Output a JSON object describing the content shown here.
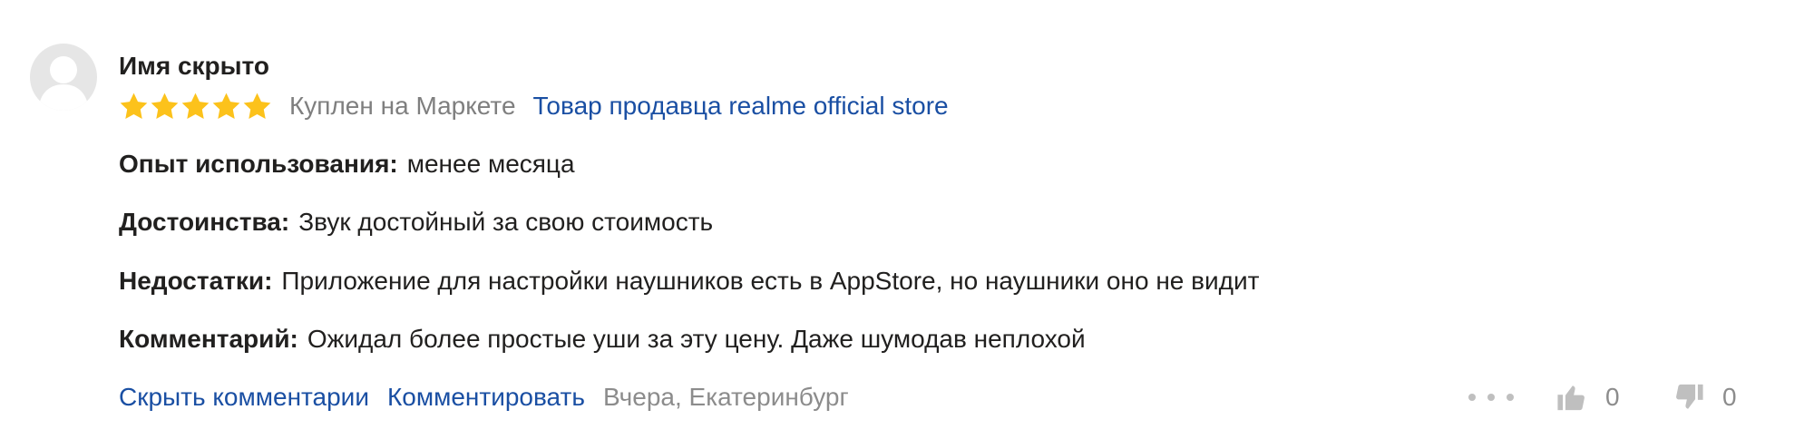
{
  "review": {
    "author": "Имя скрыто",
    "rating": 5,
    "rating_max": 5,
    "purchase_badge": "Куплен на Маркете",
    "seller_link": "Товар продавца realme official store",
    "fields": [
      {
        "label": "Опыт использования:",
        "value": "менее месяца"
      },
      {
        "label": "Достоинства:",
        "value": "Звук достойный за свою стоимость"
      },
      {
        "label": "Недостатки:",
        "value": "Приложение для настройки наушников есть в AppStore, но наушники оно не видит"
      },
      {
        "label": "Комментарий:",
        "value": "Ожидал более простые уши за эту цену. Даже шумодав неплохой"
      }
    ],
    "footer": {
      "hide_comments": "Скрыть комментарии",
      "comment": "Комментировать",
      "date_city": "Вчера, Екатеринбург"
    },
    "votes": {
      "likes": "0",
      "dislikes": "0"
    }
  },
  "colors": {
    "star": "#fcc21b",
    "link": "#1a4fa3",
    "muted_text": "#7f7f7f",
    "icon_gray": "#bfbfbf",
    "avatar_bg": "#e6e6e6"
  },
  "icons": {
    "avatar": "user-silhouette",
    "star": "star-filled",
    "more": "three-dots",
    "like": "thumbs-up",
    "dislike": "thumbs-down"
  }
}
